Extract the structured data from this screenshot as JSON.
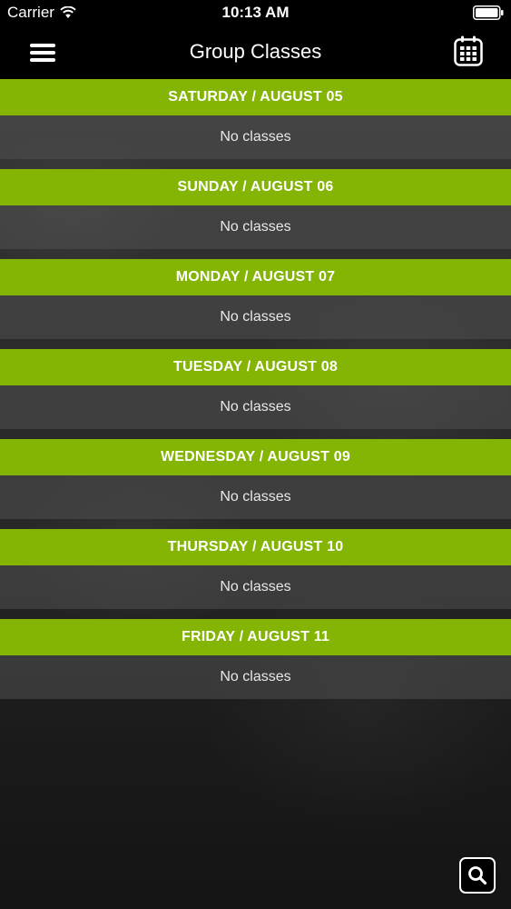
{
  "status_bar": {
    "carrier": "Carrier",
    "time": "10:13 AM",
    "icons": [
      "wifi-icon",
      "battery-icon"
    ]
  },
  "nav": {
    "title": "Group Classes",
    "left_icon": "hamburger-menu-icon",
    "right_icon": "calendar-icon"
  },
  "days": [
    {
      "header": "SATURDAY / AUGUST 05",
      "message": "No classes"
    },
    {
      "header": "SUNDAY / AUGUST 06",
      "message": "No classes"
    },
    {
      "header": "MONDAY / AUGUST 07",
      "message": "No classes"
    },
    {
      "header": "TUESDAY / AUGUST 08",
      "message": "No classes"
    },
    {
      "header": "WEDNESDAY / AUGUST 09",
      "message": "No classes"
    },
    {
      "header": "THURSDAY / AUGUST 10",
      "message": "No classes"
    },
    {
      "header": "FRIDAY / AUGUST 11",
      "message": "No classes"
    }
  ],
  "search_icon": "search-icon",
  "colors": {
    "accent_green": "#84b404",
    "topbar": "#000000",
    "text": "#ffffff"
  }
}
